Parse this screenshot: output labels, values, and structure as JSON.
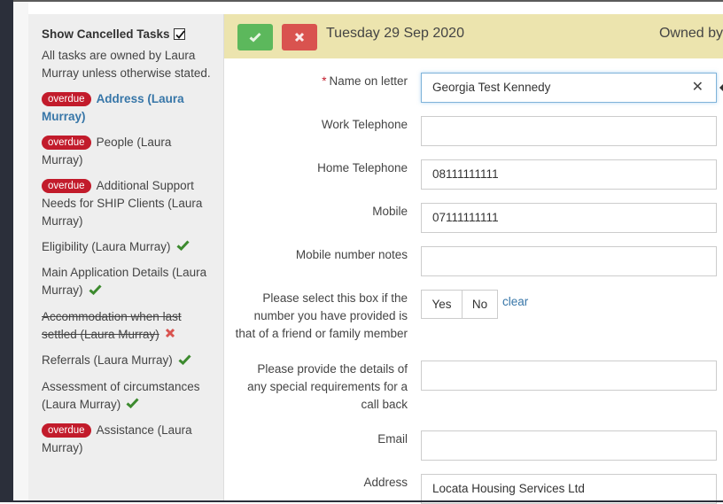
{
  "sidebar": {
    "show_cancelled_label": "Show Cancelled Tasks",
    "show_cancelled_checked": true,
    "ownership_note": "All tasks are owned by Laura Murray unless otherwise stated.",
    "tasks": [
      {
        "badge": "overdue",
        "label": "Address (Laura Murray)",
        "status": "current"
      },
      {
        "badge": "overdue",
        "label": "People (Laura Murray)",
        "status": "pending"
      },
      {
        "badge": "overdue",
        "label": "Additional Support Needs for SHIP Clients (Laura Murray)",
        "status": "pending"
      },
      {
        "badge": "",
        "label": "Eligibility (Laura Murray)",
        "status": "complete"
      },
      {
        "badge": "",
        "label": "Main Application Details (Laura Murray)",
        "status": "complete"
      },
      {
        "badge": "",
        "label": "Accommodation when last settled (Laura Murray)",
        "status": "cancelled"
      },
      {
        "badge": "",
        "label": "Referrals (Laura Murray)",
        "status": "complete"
      },
      {
        "badge": "",
        "label": "Assessment of circumstances (Laura Murray)",
        "status": "complete"
      },
      {
        "badge": "overdue",
        "label": "Assistance (Laura Murray)",
        "status": "pending"
      }
    ]
  },
  "header": {
    "date": "Tuesday 29 Sep 2020",
    "owner_label": "Owned by"
  },
  "form": {
    "name_on_letter": {
      "label": "Name on letter",
      "required": true,
      "value": "Georgia Test Kennedy"
    },
    "work_telephone": {
      "label": "Work Telephone",
      "value": ""
    },
    "home_telephone": {
      "label": "Home Telephone",
      "value": "08111111111"
    },
    "mobile": {
      "label": "Mobile",
      "value": "07111111111"
    },
    "mobile_notes": {
      "label": "Mobile number notes",
      "value": ""
    },
    "friend_family": {
      "label": "Please select this box if the number you have provided is that of a friend or family member",
      "yes": "Yes",
      "no": "No",
      "clear": "clear"
    },
    "special_requirements": {
      "label": "Please provide the details of any special requirements for a call back",
      "value": ""
    },
    "email": {
      "label": "Email",
      "value": ""
    },
    "address": {
      "label": "Address",
      "value": "Locata Housing Services Ltd"
    }
  },
  "colors": {
    "header_bg": "#ece4ae",
    "confirm_green": "#5cb85c",
    "cancel_red": "#d9534f",
    "badge_red": "#c21b2b",
    "link_blue": "#3776a8",
    "tick_green": "#3c8a2e"
  }
}
